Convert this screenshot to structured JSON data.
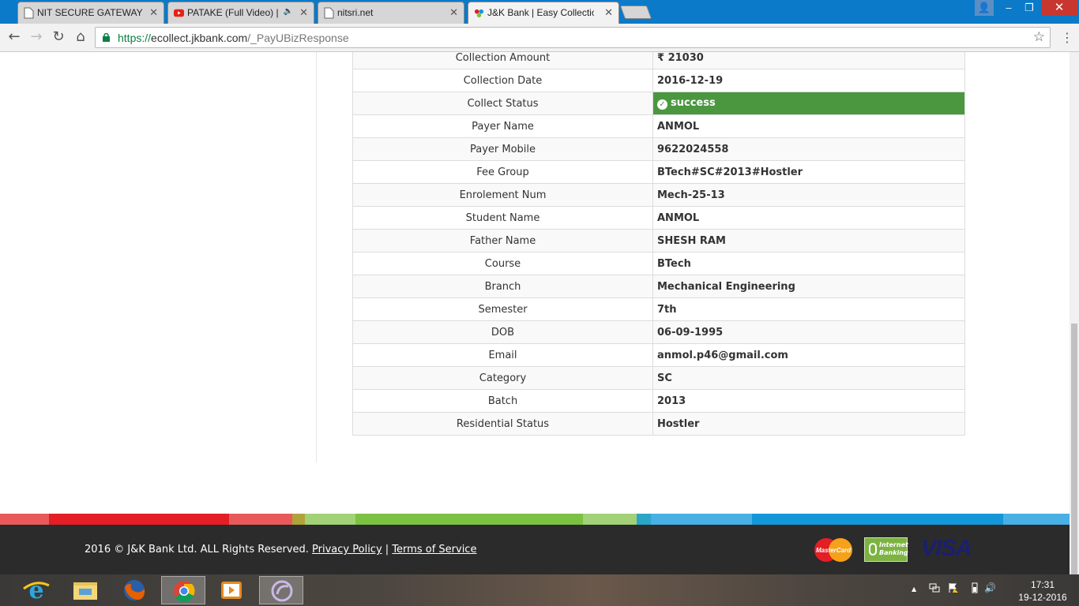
{
  "tabs": [
    {
      "title": "NIT SECURE GATEWAY",
      "icon": "page-icon"
    },
    {
      "title": "PATAKE (Full Video) ||",
      "icon": "youtube-icon",
      "audio": "🔈"
    },
    {
      "title": "nitsri.net",
      "icon": "page-icon"
    },
    {
      "title": "J&K Bank | Easy Collectio",
      "icon": "jk-bank-icon",
      "active": true
    }
  ],
  "window": {
    "user_icon": "👤",
    "minimize": "–",
    "maximize": "❐",
    "close": "✕"
  },
  "toolbar": {
    "back": "←",
    "forward": "→",
    "reload": "↻",
    "home": "⌂",
    "url_scheme": "https://",
    "url_host": "ecollect.jkbank.com",
    "url_path": "/_PayUBizResponse",
    "bookmark": "☆",
    "menu": "⋮"
  },
  "details": [
    {
      "label": "Collection Amount",
      "value": "₹ 21030"
    },
    {
      "label": "Collection Date",
      "value": "2016-12-19"
    },
    {
      "label": "Collect Status",
      "value": "success",
      "status": "success"
    },
    {
      "label": "Payer Name",
      "value": "ANMOL"
    },
    {
      "label": "Payer Mobile",
      "value": "9622024558"
    },
    {
      "label": "Fee Group",
      "value": "BTech#SC#2013#Hostler"
    },
    {
      "label": "Enrolement Num",
      "value": "Mech-25-13"
    },
    {
      "label": "Student Name",
      "value": "ANMOL"
    },
    {
      "label": "Father Name",
      "value": "SHESH RAM"
    },
    {
      "label": "Course",
      "value": "BTech"
    },
    {
      "label": "Branch",
      "value": "Mechanical Engineering"
    },
    {
      "label": "Semester",
      "value": "7th"
    },
    {
      "label": "DOB",
      "value": "06-09-1995"
    },
    {
      "label": "Email",
      "value": "anmol.p46@gmail.com"
    },
    {
      "label": "Category",
      "value": "SC"
    },
    {
      "label": "Batch",
      "value": "2013"
    },
    {
      "label": "Residential Status",
      "value": "Hostler"
    }
  ],
  "colors": {
    "success": "#4a9740",
    "footer_bg": "#2b2b2b",
    "stripe": [
      "#e85a5a",
      "#e31e24",
      "#e85a5a",
      "#b0a33a",
      "#a3d177",
      "#7cc242",
      "#a3d177",
      "#2aa6c9",
      "#48b0e4",
      "#1497d9",
      "#48b0e4"
    ]
  },
  "footer": {
    "copyright": "2016 © J&K Bank Ltd. ALL Rights Reserved.",
    "privacy": "Privacy Policy",
    "separator": "|",
    "terms": "Terms of Service",
    "mastercard_text": "MasterCard",
    "internet_banking_line1": "Internet",
    "internet_banking_line2": "Banking",
    "visa": "VISA"
  },
  "taskbar": {
    "apps": [
      "internet-explorer-icon",
      "file-explorer-icon",
      "firefox-icon",
      "chrome-icon",
      "media-player-icon",
      "bittorrent-icon"
    ],
    "tray": {
      "show_hidden": "▲",
      "volume": "🔊"
    },
    "time": "17:31",
    "date": "19-12-2016"
  }
}
